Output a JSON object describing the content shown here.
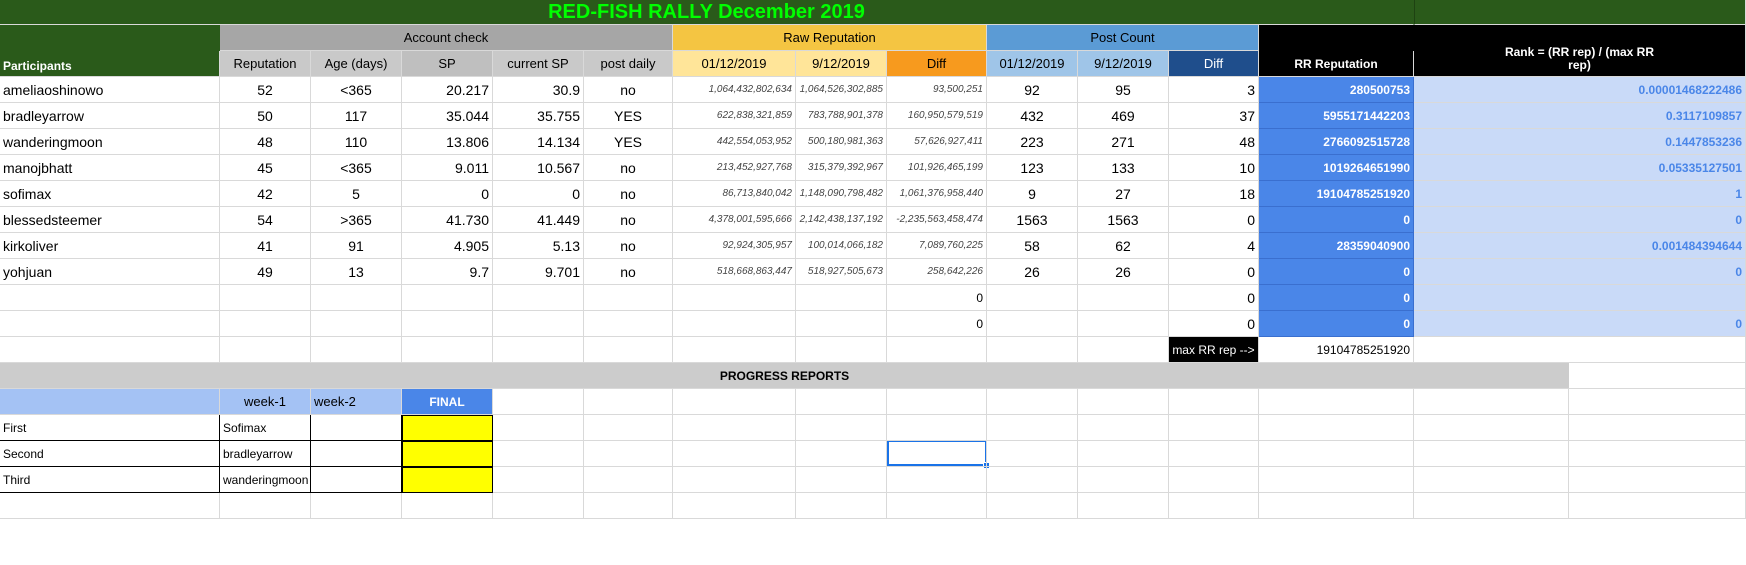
{
  "title": "RED-FISH RALLY December 2019",
  "colors": {
    "title_bar": "#2a5a1a",
    "title_text": "#00ff00",
    "account_header": "#a6a6a6",
    "account_sub": "#c9c9c9",
    "sp_col": "#bfbfbf",
    "raw_header": "#f4c542",
    "raw_sub": "#ffe599",
    "diff_orange": "#f79a1e",
    "post_header": "#5b9bd5",
    "post_sub": "#9fc5e8",
    "post_diff": "#1f4e8c",
    "rr_header": "#000000",
    "rr_cell": "#4a86e8",
    "rank_cell": "#c9daf8",
    "rank_text": "#4a86e8",
    "progress_bar": "#cccccc",
    "progress_head": "#a4c2f4",
    "final": "#4a86e8",
    "yellow": "#ffff00"
  },
  "headers": {
    "account_check": "Account check",
    "raw_reputation": "Raw Reputation",
    "post_count": "Post Count",
    "participants": "Participants",
    "reputation": "Reputation",
    "age_days": "Age (days)",
    "sp": "SP",
    "current_sp": "current SP",
    "post_daily": "post daily",
    "raw_date1": "01/12/2019",
    "raw_date2": "9/12/2019",
    "raw_diff": "Diff",
    "post_date1": "01/12/2019",
    "post_date2": "9/12/2019",
    "post_diff": "Diff",
    "rr_reputation": "RR Reputation",
    "rank_line1": "Rank = (RR rep) / (max RR",
    "rank_line2": "rep)"
  },
  "rows": [
    {
      "name": "ameliaoshinowo",
      "rep": "52",
      "age": "<365",
      "sp": "20.217",
      "csp": "30.9",
      "daily": "no",
      "raw1": "1,064,432,802,634",
      "raw2": "1,064,526,302,885",
      "rawdiff": "93,500,251",
      "p1": "92",
      "p2": "95",
      "pdiff": "3",
      "rr": "280500753",
      "rank": "0.00001468222486"
    },
    {
      "name": "bradleyarrow",
      "rep": "50",
      "age": "117",
      "sp": "35.044",
      "csp": "35.755",
      "daily": "YES",
      "raw1": "622,838,321,859",
      "raw2": "783,788,901,378",
      "rawdiff": "160,950,579,519",
      "p1": "432",
      "p2": "469",
      "pdiff": "37",
      "rr": "5955171442203",
      "rank": "0.3117109857"
    },
    {
      "name": "wanderingmoon",
      "rep": "48",
      "age": "110",
      "sp": "13.806",
      "csp": "14.134",
      "daily": "YES",
      "raw1": "442,554,053,952",
      "raw2": "500,180,981,363",
      "rawdiff": "57,626,927,411",
      "p1": "223",
      "p2": "271",
      "pdiff": "48",
      "rr": "2766092515728",
      "rank": "0.1447853236"
    },
    {
      "name": "manojbhatt",
      "rep": "45",
      "age": "<365",
      "sp": "9.011",
      "csp": "10.567",
      "daily": "no",
      "raw1": "213,452,927,768",
      "raw2": "315,379,392,967",
      "rawdiff": "101,926,465,199",
      "p1": "123",
      "p2": "133",
      "pdiff": "10",
      "rr": "1019264651990",
      "rank": "0.05335127501"
    },
    {
      "name": "sofimax",
      "rep": "42",
      "age": "5",
      "sp": "0",
      "csp": "0",
      "daily": "no",
      "raw1": "86,713,840,042",
      "raw2": "1,148,090,798,482",
      "rawdiff": "1,061,376,958,440",
      "p1": "9",
      "p2": "27",
      "pdiff": "18",
      "rr": "19104785251920",
      "rank": "1"
    },
    {
      "name": "blessedsteemer",
      "rep": "54",
      "age": ">365",
      "sp": "41.730",
      "csp": "41.449",
      "daily": "no",
      "raw1": "4,378,001,595,666",
      "raw2": "2,142,438,137,192",
      "rawdiff": "-2,235,563,458,474",
      "p1": "1563",
      "p2": "1563",
      "pdiff": "0",
      "rr": "0",
      "rank": "0"
    },
    {
      "name": "kirkoliver",
      "rep": "41",
      "age": "91",
      "sp": "4.905",
      "csp": "5.13",
      "daily": "no",
      "raw1": "92,924,305,957",
      "raw2": "100,014,066,182",
      "rawdiff": "7,089,760,225",
      "p1": "58",
      "p2": "62",
      "pdiff": "4",
      "rr": "28359040900",
      "rank": "0.001484394644"
    },
    {
      "name": "yohjuan",
      "rep": "49",
      "age": "13",
      "sp": "9.7",
      "csp": "9.701",
      "daily": "no",
      "raw1": "518,668,863,447",
      "raw2": "518,927,505,673",
      "rawdiff": "258,642,226",
      "p1": "26",
      "p2": "26",
      "pdiff": "0",
      "rr": "0",
      "rank": "0"
    },
    {
      "name": "",
      "rep": "",
      "age": "",
      "sp": "",
      "csp": "",
      "daily": "",
      "raw1": "",
      "raw2": "",
      "rawdiff": "0",
      "p1": "",
      "p2": "",
      "pdiff": "0",
      "rr": "0",
      "rank": ""
    },
    {
      "name": "",
      "rep": "",
      "age": "",
      "sp": "",
      "csp": "",
      "daily": "",
      "raw1": "",
      "raw2": "",
      "rawdiff": "0",
      "p1": "",
      "p2": "",
      "pdiff": "0",
      "rr": "0",
      "rank": "0"
    }
  ],
  "max_rr_label": "max RR rep -->",
  "max_rr_value": "19104785251920",
  "progress": {
    "title": "PROGRESS REPORTS",
    "week1": "week-1",
    "week2": "week-2",
    "final": "FINAL",
    "rows": [
      {
        "label": "First",
        "w1": "Sofimax"
      },
      {
        "label": "Second",
        "w1": "bradleyarrow"
      },
      {
        "label": "Third",
        "w1": "wanderingmoon"
      }
    ]
  }
}
